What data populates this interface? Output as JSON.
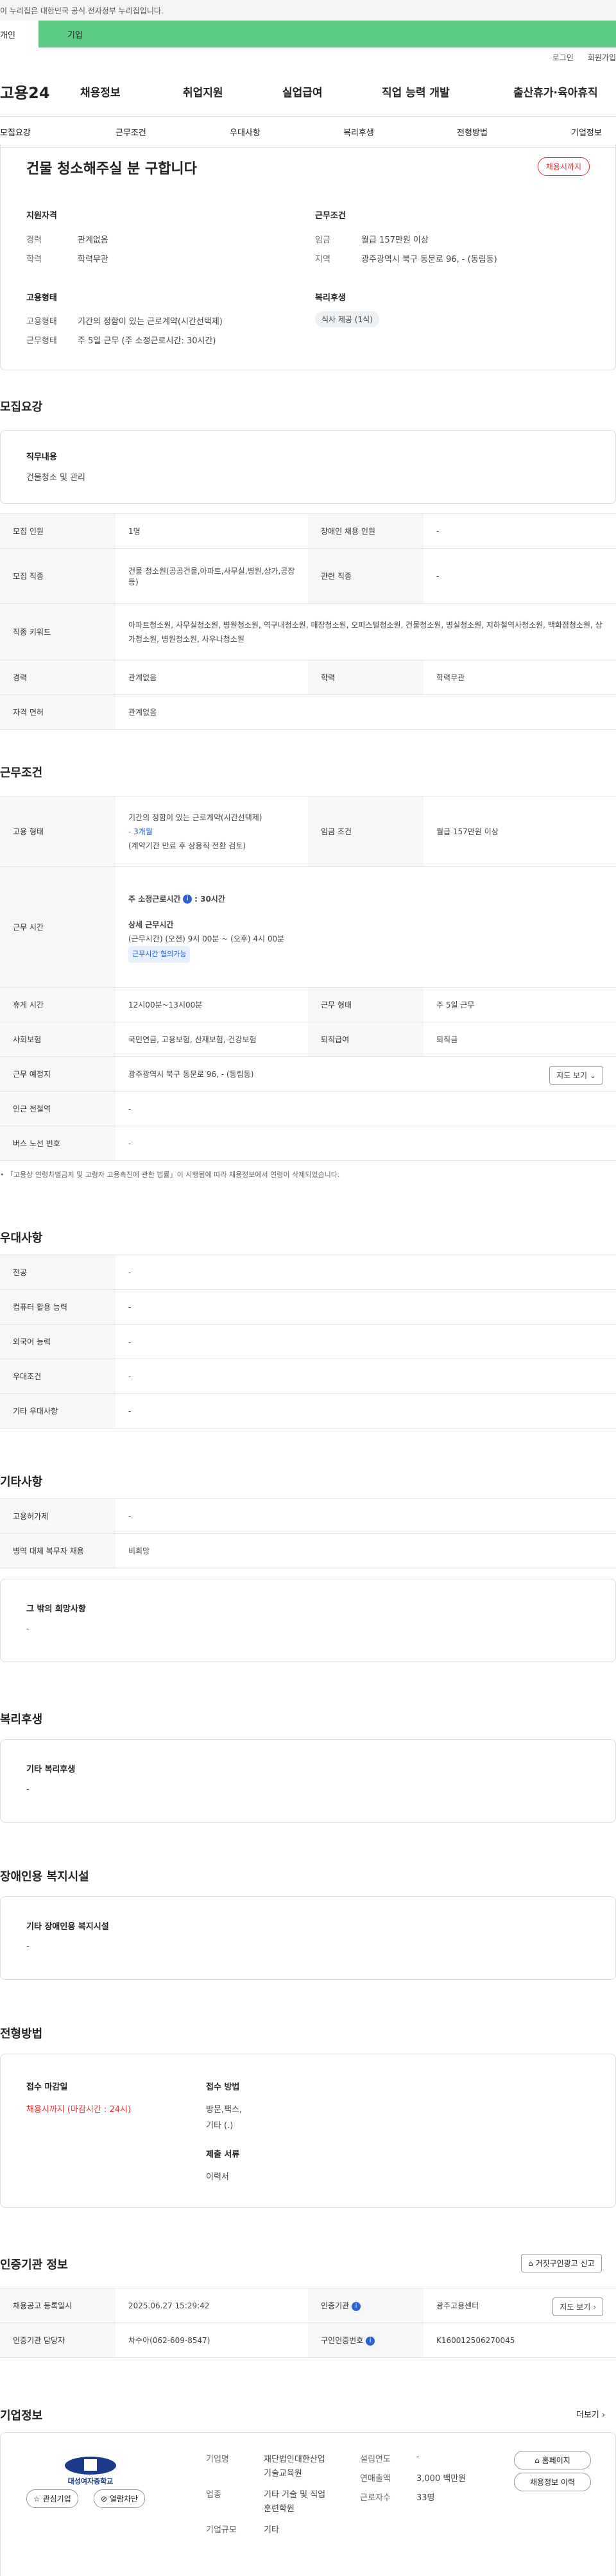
{
  "gov_banner": "이 누리집은 대한민국 공식 전자정부 누리집입니다.",
  "tabs": [
    "개인",
    "기업"
  ],
  "util": [
    "로그인",
    "회원가입"
  ],
  "logo": "고용24",
  "gnb": [
    "채용정보",
    "취업지원",
    "실업급여",
    "직업 능력 개발",
    "출산휴가·육아휴직"
  ],
  "subnav": [
    "모집요강",
    "근무조건",
    "우대사항",
    "복리후생",
    "전형방법",
    "기업정보"
  ],
  "summary": {
    "title": "건물 청소해주실 분 구합니다",
    "status": "채용시까지",
    "qual_title": "지원자격",
    "career_k": "경력",
    "career_v": "관계없음",
    "edu_k": "학력",
    "edu_v": "학력무관",
    "emp_title": "고용형태",
    "emptype_k": "고용형태",
    "emptype_v": "기간의 정함이 있는 근로계약(시간선택제)",
    "worktype_k": "근무형태",
    "worktype_v": "주 5일 근무 (주 소정근로시간: 30시간)",
    "cond_title": "근무조건",
    "wage_k": "임금",
    "wage_v": "월급 157만원 이상",
    "region_k": "지역",
    "region_v": "광주광역시 북구 동문로 96, - (동림동)",
    "welfare_title": "복리후생",
    "welfare_chip": "식사 제공 (1식)"
  },
  "recruit": {
    "title": "모집요강",
    "duty_title": "직무내용",
    "duty_value": "건물청소 및 관리",
    "rows": [
      {
        "k1": "모집 인원",
        "v1": "1명",
        "k2": "장애인 채용 인원",
        "v2": "-"
      },
      {
        "k1": "모집 직종",
        "v1": "건물 청소원(공공건물,아파트,사무실,병원,상가,공장 등)",
        "k2": "관련 직종",
        "v2": "-"
      },
      {
        "k1": "직종 키워드",
        "v1": "아파트청소원, 사무실청소원, 병원청소원, 역구내청소원, 매장청소원, 오피스텔청소원, 건물청소원, 병실청소원, 지하철역사청소원, 백화점청소원, 상가청소원, 병원청소원, 사우나청소원"
      },
      {
        "k1": "경력",
        "v1": "관계없음",
        "k2": "학력",
        "v2": "학력무관"
      },
      {
        "k1": "자격 면허",
        "v1": "관계없음"
      }
    ]
  },
  "work": {
    "title": "근무조건",
    "emp_k": "고용 형태",
    "emp_v1": "기간의 정함이 있는 근로계약(시간선택제)",
    "emp_v2": "- 3개월",
    "emp_v3": "(계약기간 만료 후 상용직 전환 검토)",
    "wage_k": "임금 조건",
    "wage_v": "월급 157만원 이상",
    "hours_k": "근무 시간",
    "hours_v0": "-",
    "hours_v1": "주 소정근로시간",
    "hours_v1b": ": 30시간",
    "hours_v2": "상세 근무시간",
    "hours_v3": "(근무시간) (오전) 9시 00분 ~ (오후) 4시 00분",
    "hours_badge": "근무시간 협의가능",
    "break_k": "휴게 시간",
    "break_v": "12시00분~13시00분",
    "wt_k": "근무 형태",
    "wt_v": "주 5일 근무",
    "ins_k": "사회보험",
    "ins_v": "국민연금, 고용보험, 산재보험, 건강보험",
    "ret_k": "퇴직급여",
    "ret_v": "퇴직금",
    "loc_k": "근무 예정지",
    "loc_v": "광주광역시 북구 동문로 96, - (동림동)",
    "map_btn": "지도 보기",
    "sub_k": "인근 전철역",
    "sub_v": "-",
    "bus_k": "버스 노선 번호",
    "bus_v": "-",
    "note": "「고용상 연령차별금지 및 고령자 고용촉진에 관한 법률」이 시행됨에 따라 채용정보에서 연령이 삭제되었습니다."
  },
  "pref": {
    "title": "우대사항",
    "rows": [
      {
        "k": "전공",
        "v": "-"
      },
      {
        "k": "컴퓨터 활용 능력",
        "v": "-"
      },
      {
        "k": "외국어 능력",
        "v": "-"
      },
      {
        "k": "우대조건",
        "v": "-"
      },
      {
        "k": "기타 우대사항",
        "v": "-"
      }
    ]
  },
  "etc": {
    "title": "기타사항",
    "rows": [
      {
        "k": "고용허가제",
        "v": "-"
      },
      {
        "k": "병역 대체 복무자 채용",
        "v": "비희망"
      }
    ],
    "box_title": "그 밖의 희망사항",
    "box_value": "-"
  },
  "welfare": {
    "title": "복리후생",
    "box_title": "기타 복리후생",
    "box_value": "-"
  },
  "disab": {
    "title": "장애인용 복지시설",
    "box_title": "기타 장애인용 복지시설",
    "box_value": "-"
  },
  "select": {
    "title": "전형방법",
    "deadline_k": "접수 마감일",
    "deadline_v": "채용시까지 (마감시간 : 24시)",
    "method_k": "접수 방법",
    "method_v1": "방문,팩스,",
    "method_v2": "기타 (.)",
    "docs_k": "제출 서류",
    "docs_v": "이력서"
  },
  "agency": {
    "title": "인증기관 정보",
    "report_btn": "거짓구인광고 신고",
    "reg_k": "채용공고 등록일시",
    "reg_v": "2025.06.27 15:29:42",
    "org_k": "인증기관",
    "org_v": "광주고용센터",
    "map_btn": "지도 보기",
    "mgr_k": "인증기관 담당자",
    "mgr_v": "차수아(062-609-8547)",
    "num_k": "구인인증번호",
    "num_v": "K160012506270045"
  },
  "company": {
    "title": "기업정보",
    "more": "더보기",
    "logo_text": "대성여자중학교",
    "fav_btn": "관심기업",
    "block_btn": "열람차단",
    "name_k": "기업명",
    "name_v1": "재단법인대한산업",
    "name_v2": "기술교육원",
    "ind_k": "업종",
    "ind_v1": "기타 기술 및 직업",
    "ind_v2": "훈련학원",
    "size_k": "기업규모",
    "size_v": "기타",
    "est_k": "설립연도",
    "est_v": "-",
    "sales_k": "연매출액",
    "sales_v": "3,000 백만원",
    "emp_k": "근로자수",
    "emp_v": "33명",
    "home_btn": "홈페이지",
    "jobs_btn": "채용정보 이력"
  }
}
